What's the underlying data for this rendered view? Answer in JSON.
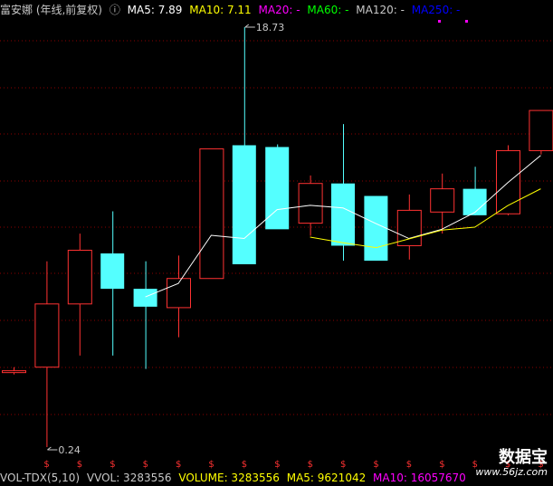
{
  "header": {
    "title": "富安娜 (年线,前复权)",
    "circle_icon": "ⓘ",
    "ma": [
      {
        "label": "MA5: 7.89",
        "color": "#ffffff"
      },
      {
        "label": "MA10: 7.11",
        "color": "#ffff00"
      },
      {
        "label": "MA20: -",
        "color": "#ff00ff"
      },
      {
        "label": "MA60: -",
        "color": "#00ff00"
      },
      {
        "label": "MA120: -",
        "color": "#c8c8c8"
      },
      {
        "label": "MA250: -",
        "color": "#0000ff"
      }
    ]
  },
  "footer": {
    "items": [
      {
        "label": "VOL-TDX(5,10)",
        "color": "#c8c8c8"
      },
      {
        "label": "VVOL: 3283556",
        "color": "#c8c8c8"
      },
      {
        "label": "VOLUME: 3283556",
        "color": "#ffff00"
      },
      {
        "label": "MA5: 9621042",
        "color": "#ffff00"
      },
      {
        "label": "MA10: 16057670",
        "color": "#ff00ff"
      }
    ]
  },
  "watermark": {
    "big": "数据宝",
    "small": "www.56jz.com"
  },
  "colors": {
    "up": "#ff3232",
    "down": "#54ffff",
    "ma5": "#ffffff",
    "ma10": "#ffff00",
    "grid": "#8b0000",
    "dollar": "#ff3232"
  },
  "chart_data": {
    "type": "candlestick",
    "y_scale": "log",
    "annotations": [
      {
        "label": "18.73",
        "index": 7,
        "value": 18.73,
        "kind": "max"
      },
      {
        "label": "0.24",
        "index": 1,
        "value": 0.24,
        "kind": "min"
      }
    ],
    "dividend_marker": "$",
    "candles": [
      {
        "o": 0.52,
        "h": 0.55,
        "l": 0.51,
        "c": 0.53
      },
      {
        "o": 0.55,
        "h": 1.65,
        "l": 0.24,
        "c": 1.06
      },
      {
        "o": 1.06,
        "h": 2.2,
        "l": 0.62,
        "c": 1.85
      },
      {
        "o": 1.79,
        "h": 2.77,
        "l": 0.62,
        "c": 1.24
      },
      {
        "o": 1.24,
        "h": 1.65,
        "l": 0.54,
        "c": 1.03
      },
      {
        "o": 1.02,
        "h": 1.75,
        "l": 0.75,
        "c": 1.38
      },
      {
        "o": 1.38,
        "h": 5.3,
        "l": 1.38,
        "c": 5.3
      },
      {
        "o": 5.5,
        "h": 18.73,
        "l": 1.62,
        "c": 1.6
      },
      {
        "o": 5.4,
        "h": 5.55,
        "l": 2.45,
        "c": 2.3
      },
      {
        "o": 2.45,
        "h": 4.02,
        "l": 2.15,
        "c": 3.7
      },
      {
        "o": 3.7,
        "h": 6.85,
        "l": 1.66,
        "c": 1.94
      },
      {
        "o": 3.25,
        "h": 3.25,
        "l": 1.66,
        "c": 1.66
      },
      {
        "o": 1.94,
        "h": 3.3,
        "l": 1.68,
        "c": 2.8
      },
      {
        "o": 2.75,
        "h": 4.1,
        "l": 2.2,
        "c": 3.5
      },
      {
        "o": 3.5,
        "h": 4.4,
        "l": 2.66,
        "c": 2.66
      },
      {
        "o": 2.7,
        "h": 5.5,
        "l": 2.66,
        "c": 5.2
      },
      {
        "o": 5.2,
        "h": 7.9,
        "l": 5.0,
        "c": 7.89
      }
    ],
    "ma5": [
      null,
      null,
      null,
      null,
      1.14,
      1.31,
      2.16,
      2.09,
      2.82,
      2.95,
      2.87,
      2.44,
      2.09,
      2.3,
      2.74,
      3.73,
      4.95
    ],
    "ma10": [
      null,
      null,
      null,
      null,
      null,
      null,
      null,
      null,
      null,
      2.12,
      2.0,
      1.9,
      2.08,
      2.28,
      2.35,
      2.94,
      3.5
    ]
  }
}
